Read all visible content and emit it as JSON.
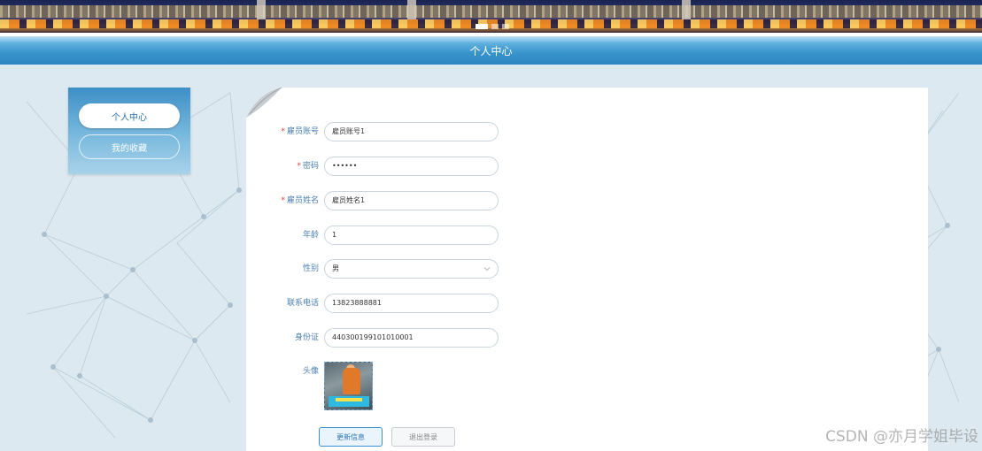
{
  "header": {
    "title": "个人中心"
  },
  "banner": {
    "slides": 3,
    "active_slide": 1
  },
  "sidebar": {
    "items": [
      {
        "label": "个人中心",
        "active": true
      },
      {
        "label": "我的收藏",
        "active": false
      }
    ]
  },
  "form": {
    "fields": [
      {
        "label": "雇员账号",
        "required": true,
        "value": "雇员账号1"
      },
      {
        "label": "密码",
        "required": true,
        "value": "••••••"
      },
      {
        "label": "雇员姓名",
        "required": true,
        "value": "雇员姓名1"
      },
      {
        "label": "年龄",
        "required": false,
        "value": "1"
      },
      {
        "label": "性别",
        "required": false,
        "value": "男"
      },
      {
        "label": "联系电话",
        "required": false,
        "value": "13823888881"
      },
      {
        "label": "身份证",
        "required": false,
        "value": "440300199101010001"
      }
    ],
    "avatar_label": "头像",
    "required_mark": "*",
    "update_button": "更新信息",
    "logout_button": "退出登录"
  },
  "watermark": "CSDN @亦月学姐毕设"
}
